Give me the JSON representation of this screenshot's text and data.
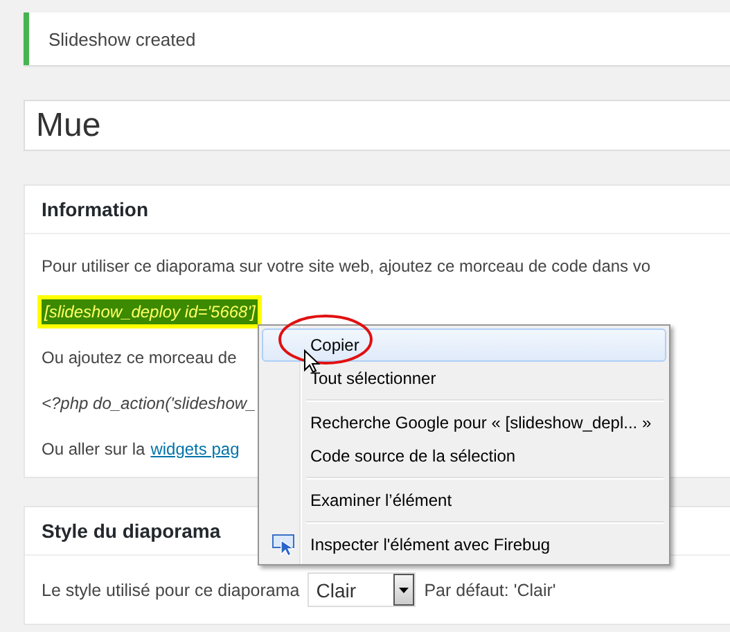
{
  "notice": {
    "text": "Slideshow created"
  },
  "title_field": {
    "value": "Mue"
  },
  "information": {
    "heading": "Information",
    "intro": "Pour utiliser ce diaporama sur votre site web, ajoutez ce morceau de code dans vo",
    "shortcode": "[slideshow_deploy id='5668']",
    "shortcode_selected": true,
    "alt_text": "Ou ajoutez ce morceau de",
    "php_code": "<?php do_action('slideshow_",
    "widgets_prefix": "Ou aller sur la",
    "widgets_link": "widgets pag"
  },
  "context_menu": {
    "items": [
      {
        "kind": "item",
        "label": "Copier",
        "selected": true
      },
      {
        "kind": "item",
        "label": "Tout sélectionner",
        "selected": false
      },
      {
        "kind": "separator"
      },
      {
        "kind": "item",
        "label": "Recherche Google pour « [slideshow_depl... »",
        "selected": false
      },
      {
        "kind": "item",
        "label": "Code source de la sélection",
        "selected": false
      },
      {
        "kind": "separator"
      },
      {
        "kind": "item",
        "label": "Examiner l’élément",
        "selected": false
      },
      {
        "kind": "separator"
      },
      {
        "kind": "icon_item",
        "label": "Inspecter l'élément avec Firebug",
        "selected": false
      }
    ]
  },
  "style_panel": {
    "heading": "Style du diaporama",
    "label": "Le style utilisé pour ce diaporama",
    "value": "Clair",
    "default_text": "Par défaut: 'Clair'"
  }
}
